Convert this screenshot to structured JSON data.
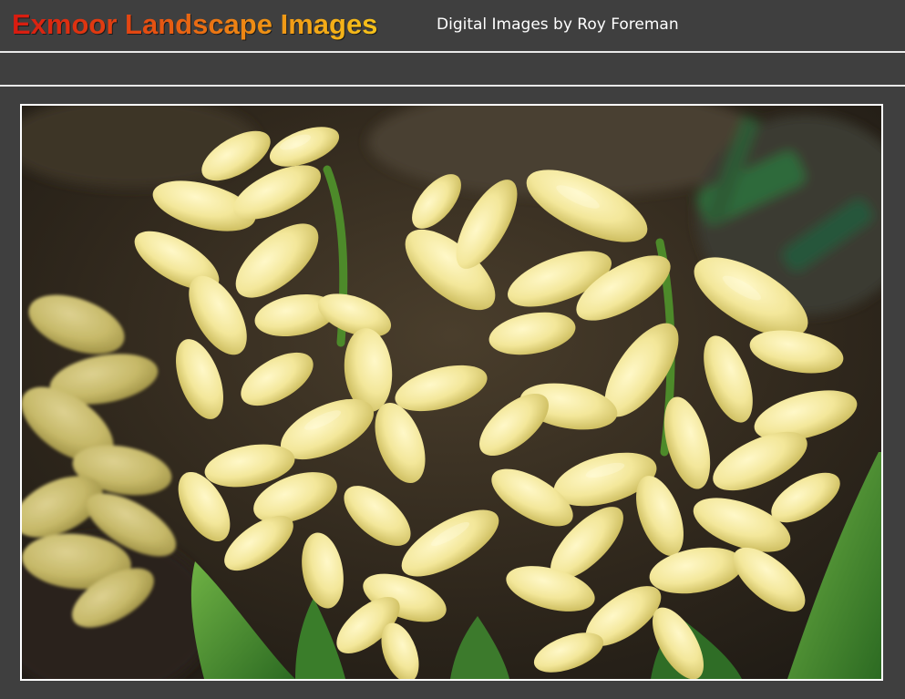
{
  "header": {
    "site_title": "Exmoor Landscape Images",
    "subtitle": "Digital Images by Roy Foreman"
  },
  "photo": {
    "subject": "hyacinth-flowers",
    "colors": {
      "petal": "#f3e79a",
      "petal_shadow": "#d8c96a",
      "stem": "#4d8a2a",
      "leaf": "#3f8a2f",
      "background_soil": "#3a2e22"
    }
  },
  "colors": {
    "page_background": "#3f3f3f",
    "divider": "#e9e9e9",
    "title_gradient_start": "#d81a10",
    "title_gradient_end": "#f6c21a"
  }
}
